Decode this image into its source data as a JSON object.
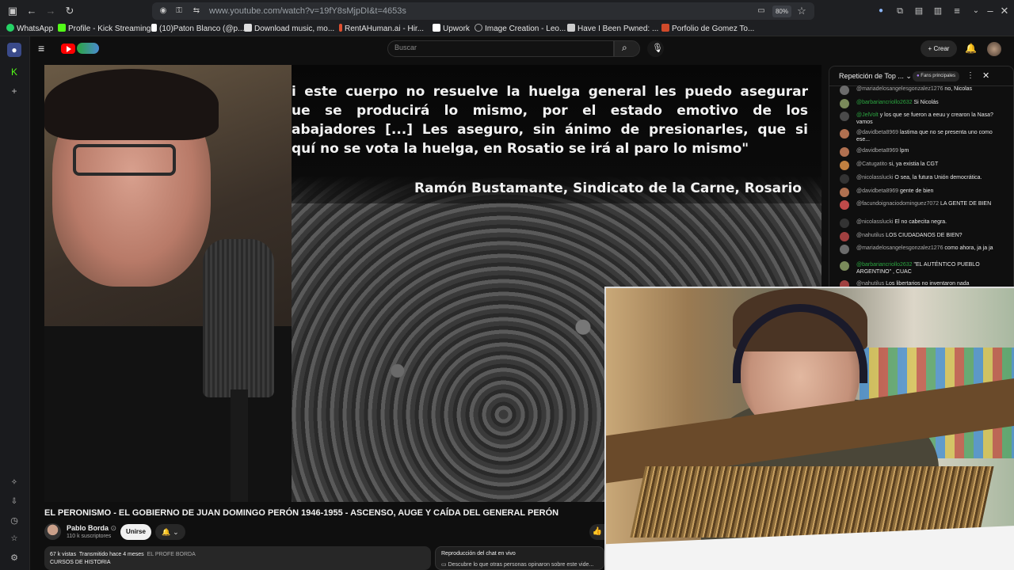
{
  "browser": {
    "url": "www.youtube.com/watch?v=19fY8sMjpDI&t=4653s",
    "zoom": "80%",
    "bookmarks": [
      {
        "label": "WhatsApp",
        "color": "#25d366"
      },
      {
        "label": "Profile - Kick Streaming",
        "color": "#53fc18"
      },
      {
        "label": "(10)Paton Blanco (@p...",
        "color": "#ffffff"
      },
      {
        "label": "Download music, mo...",
        "color": "#dddddd"
      },
      {
        "label": "RentAHuman.ai - Hir...",
        "color": "#e05030"
      },
      {
        "label": "Upwork",
        "color": "#14a800"
      },
      {
        "label": "Image Creation - Leo...",
        "color": "#aaaaaa"
      },
      {
        "label": "Have I Been Pwned: ...",
        "color": "#cccccc"
      },
      {
        "label": "Porfolio de Gomez To...",
        "color": "#d04a2a"
      }
    ]
  },
  "youtube": {
    "search_placeholder": "Buscar",
    "create_label": "Crear",
    "brand_color": "#ff0000"
  },
  "video": {
    "quote_lines": [
      "i este cuerpo no resuelve la huelga general les puedo asegurar",
      "ue se producirá lo mismo, por el estado emotivo de los",
      "abajadores [...] Les aseguro, sin ánimo de presionarles, que si",
      "quí no se vota la huelga, en Rosatio se irá al paro lo mismo\""
    ],
    "quote_author": "Ramón Bustamante, Sindicato de la Carne, Rosario",
    "title": "EL PERONISMO - EL GOBIERNO DE JUAN DOMINGO PERÓN 1946-1955 - ASCENSO, AUGE Y CAÍDA DEL GENERAL PERÓN",
    "channel": "Pablo Borda",
    "verified": "⊙",
    "subscribers": "110 k suscriptores",
    "join_label": "Unirse",
    "views": "67 k vistas",
    "streamed": "Transmitido hace 4 meses",
    "tag": "EL PROFE BORDA",
    "description_line": "CURSOS DE HISTORIA",
    "chat_replay_title": "Reproducción del chat en vivo",
    "chat_replay_text": "Descubre lo que otras personas opinaron sobre este vide..."
  },
  "chat": {
    "title": "Repetición de Top ...",
    "badge": "Fans principales",
    "messages": [
      {
        "author": "@mariadelosangelesgonzalez1276",
        "text": "no, Nicolas",
        "member": false,
        "avatar": "#6b6b6b"
      },
      {
        "author": "@barbariancriollo2632",
        "text": "Si Nicolás",
        "member": true,
        "avatar": "#7a8a5a"
      },
      {
        "author": "@JelVolt",
        "text": "y los que se fueron a eeuu y crearon la Nasa? vamos",
        "member": true,
        "avatar": "#4a4a4a"
      },
      {
        "author": "@davidbeta8969",
        "text": "lastima que no se presenta uno como ese...",
        "member": false,
        "avatar": "#b07050"
      },
      {
        "author": "@davidbeta8969",
        "text": "lpm",
        "member": false,
        "avatar": "#b07050"
      },
      {
        "author": "@Catugatito",
        "text": "si, ya existia la CGT",
        "member": false,
        "avatar": "#c08040"
      },
      {
        "author": "@nicolasslucki",
        "text": "O sea, la futura Unión democrática.",
        "member": false,
        "avatar": "#333333"
      },
      {
        "author": "@davidbeta8969",
        "text": "gente de bien",
        "member": false,
        "avatar": "#b07050"
      },
      {
        "author": "@facundoignaciodominguez7072",
        "text": "LA GENTE DE BIEN",
        "member": false,
        "avatar": "#c04a4a"
      },
      {
        "author": "@nicolasslucki",
        "text": "El no cabecita negra.",
        "member": false,
        "avatar": "#333333"
      },
      {
        "author": "@nahutilus",
        "text": "LOS CIUDADANOS DE BIEN?",
        "member": false,
        "avatar": "#a04040"
      },
      {
        "author": "@mariadelosangelesgonzalez1276",
        "text": "como ahora, ja ja ja",
        "member": false,
        "avatar": "#6b6b6b"
      },
      {
        "author": "@barbariancriollo2632",
        "text": "\"EL AUTÉNTICO PUEBLO ARGENTINO\" , CUAC",
        "member": true,
        "avatar": "#7a8a5a"
      },
      {
        "author": "@nahutilus",
        "text": "Los libertarios no inventaron nada",
        "member": false,
        "avatar": "#a04040"
      }
    ]
  }
}
